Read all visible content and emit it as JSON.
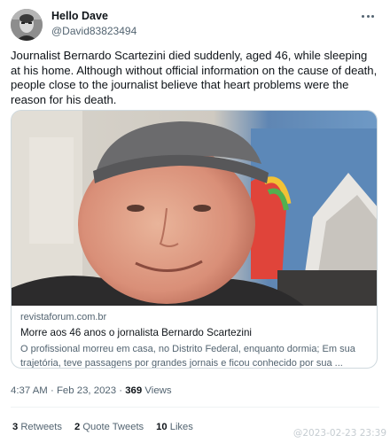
{
  "user": {
    "display_name": "Hello Dave",
    "handle": "@David83823494"
  },
  "tweet": {
    "text": "Journalist Bernardo Scartezini died suddenly, aged 46, while sleeping at his home. Although without official information on the cause of death, people close to the journalist believe that heart problems were the reason for his death."
  },
  "card": {
    "domain": "revistaforum.com.br",
    "title": "Morre aos 46 anos o jornalista Bernardo Scartezini",
    "description": "O profissional morreu em casa, no Distrito Federal, enquanto dormia; Em sua trajetória, teve passagens por grandes jornais e ficou conhecido por sua ..."
  },
  "meta": {
    "time": "4:37 AM",
    "separator": "·",
    "date": "Feb 23, 2023",
    "views_count": "369",
    "views_label": "Views"
  },
  "stats": {
    "retweets_count": "3",
    "retweets_label": "Retweets",
    "quotes_count": "2",
    "quotes_label": "Quote Tweets",
    "likes_count": "10",
    "likes_label": "Likes"
  },
  "watermark": "@2023-02-23 23:39",
  "colors": {
    "text_primary": "#0f1419",
    "text_secondary": "#536471",
    "border": "#cfd9de"
  },
  "icons": {
    "more": "more-options-icon"
  }
}
